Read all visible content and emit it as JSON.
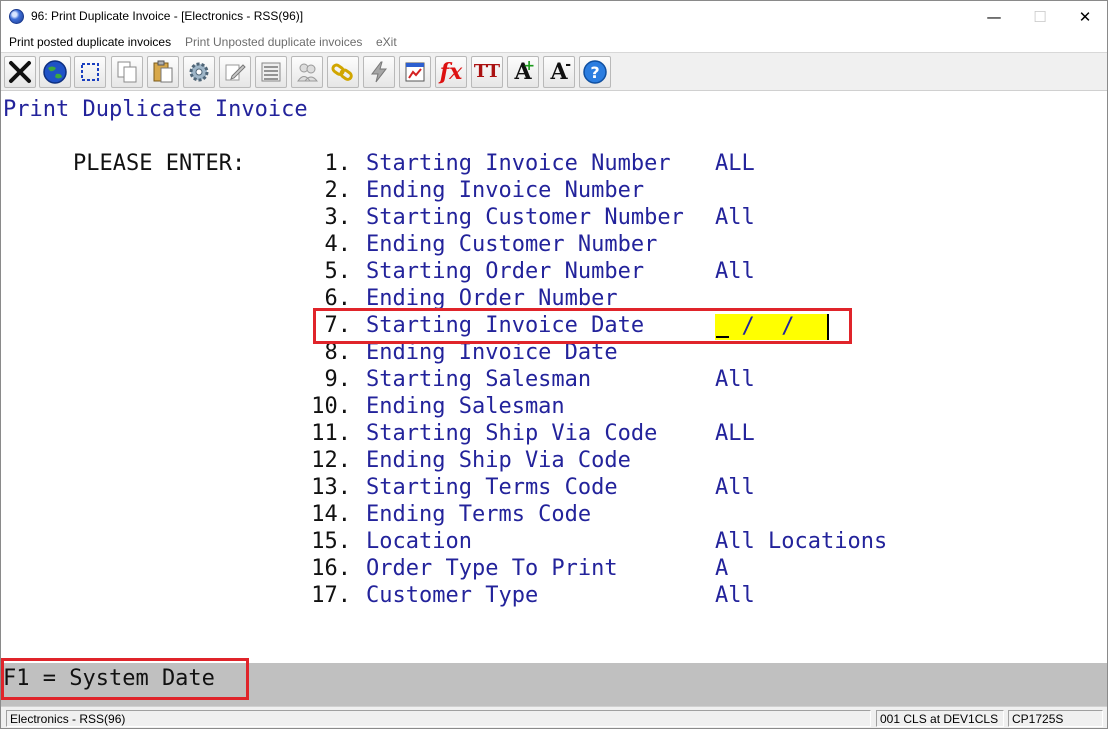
{
  "window": {
    "title": "96: Print Duplicate Invoice - [Electronics - RSS(96)]",
    "minimize": "—",
    "maximize": "☐",
    "close": "✕"
  },
  "menu": {
    "items": [
      {
        "label": "Print posted duplicate invoices",
        "state": "active"
      },
      {
        "label": "Print Unposted duplicate invoices",
        "state": "inactive"
      },
      {
        "label": "eXit",
        "state": "inactive"
      }
    ]
  },
  "toolbar": {
    "buttons": [
      "close-icon",
      "globe-icon",
      "select-icon",
      "copy-icon",
      "paste-icon",
      "settings-icon",
      "edit-icon",
      "list-icon",
      "users-icon",
      "link-icon",
      "lightning-icon",
      "chart-icon",
      "function-icon",
      "text-size-icon",
      "font-increase-icon",
      "font-decrease-icon",
      "help-icon"
    ],
    "fx_label": "fx",
    "tt_label": "TT",
    "a_label": "A"
  },
  "screen": {
    "heading": "Print Duplicate Invoice",
    "prompt": "PLEASE ENTER:",
    "fields": [
      {
        "num": "1.",
        "label": "Starting Invoice Number",
        "value": "ALL"
      },
      {
        "num": "2.",
        "label": "Ending Invoice Number",
        "value": ""
      },
      {
        "num": "3.",
        "label": "Starting Customer Number",
        "value": "All"
      },
      {
        "num": "4.",
        "label": "Ending Customer Number",
        "value": ""
      },
      {
        "num": "5.",
        "label": "Starting Order Number",
        "value": "All"
      },
      {
        "num": "6.",
        "label": "Ending Order Number",
        "value": ""
      },
      {
        "num": "7.",
        "label": "Starting Invoice Date",
        "value": "  /  /"
      },
      {
        "num": "8.",
        "label": "Ending Invoice Date",
        "value": ""
      },
      {
        "num": "9.",
        "label": "Starting Salesman",
        "value": "All"
      },
      {
        "num": "10.",
        "label": "Ending Salesman",
        "value": ""
      },
      {
        "num": "11.",
        "label": "Starting Ship Via Code",
        "value": "ALL"
      },
      {
        "num": "12.",
        "label": "Ending Ship Via Code",
        "value": ""
      },
      {
        "num": "13.",
        "label": "Starting Terms Code",
        "value": "All"
      },
      {
        "num": "14.",
        "label": "Ending Terms Code",
        "value": ""
      },
      {
        "num": "15.",
        "label": "Location",
        "value": "All Locations"
      },
      {
        "num": "16.",
        "label": "Order Type To Print",
        "value": "A"
      },
      {
        "num": "17.",
        "label": "Customer Type",
        "value": "All"
      }
    ],
    "hint": "F1 = System Date"
  },
  "status": {
    "company": "Electronics - RSS(96)",
    "session": "001 CLS at DEV1CLS",
    "program": "CP1725S"
  },
  "colors": {
    "text_blue": "#23239b",
    "highlight_red": "#e0242a",
    "field_yellow": "#ffff00",
    "hint_gray": "#c0c0c0"
  }
}
